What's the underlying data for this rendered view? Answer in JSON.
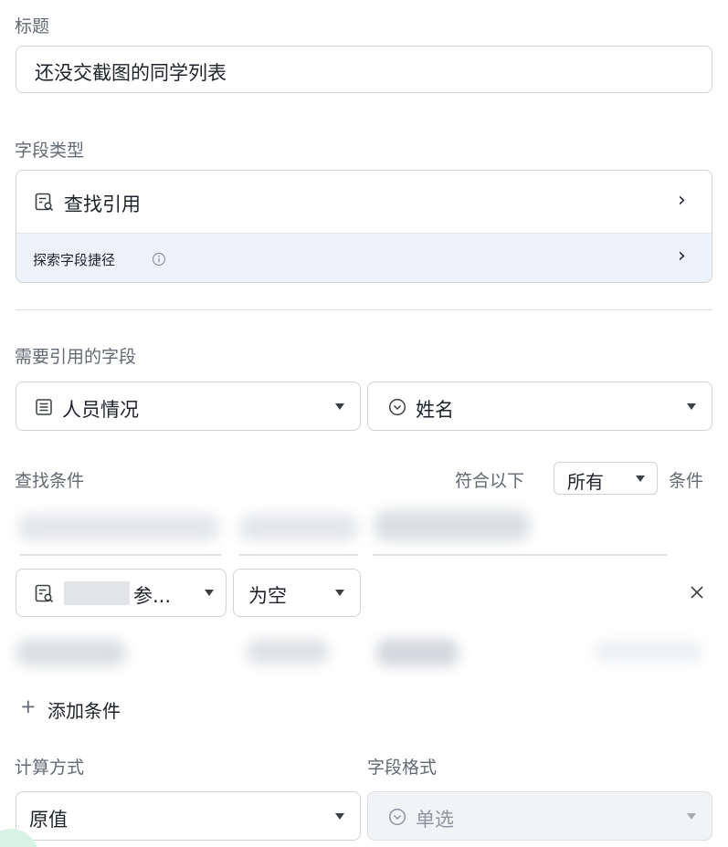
{
  "title_section": {
    "label": "标题",
    "input_value": "还没交截图的同学列表"
  },
  "field_type": {
    "label": "字段类型",
    "selected": "查找引用",
    "shortcut_label": "探索字段捷径"
  },
  "reference": {
    "label": "需要引用的字段",
    "table_select": "人员情况",
    "field_select": "姓名"
  },
  "conditions": {
    "label": "查找条件",
    "match_prefix": "符合以下",
    "match_mode": "所有",
    "match_suffix": "条件",
    "row": {
      "field_suffix": "参...",
      "operator": "为空"
    },
    "add_label": "添加条件"
  },
  "calculation": {
    "label": "计算方式",
    "value": "原值"
  },
  "format": {
    "label": "字段格式",
    "value": "单选"
  },
  "icons": {
    "lookup": "lookup-icon",
    "table": "table-icon",
    "single_select": "single-select-icon",
    "info": "info-icon",
    "chevron": "chevron-right-icon",
    "close": "close-icon",
    "plus": "plus-icon"
  }
}
